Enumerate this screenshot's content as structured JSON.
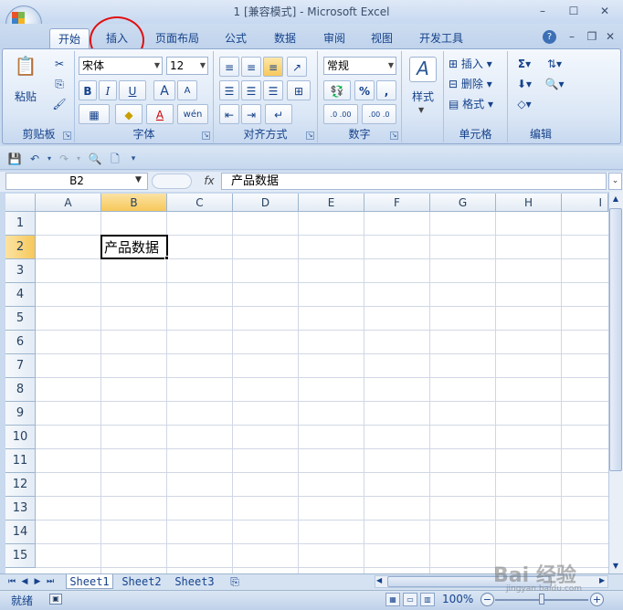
{
  "window": {
    "title": "1  [兼容模式] - Microsoft Excel",
    "min": "–",
    "max": "☐",
    "close": "✕",
    "help": "?",
    "doc_min": "–",
    "doc_restore": "❐",
    "doc_close": "✕"
  },
  "tabs": [
    {
      "label": "开始",
      "active": true
    },
    {
      "label": "插入"
    },
    {
      "label": "页面布局"
    },
    {
      "label": "公式"
    },
    {
      "label": "数据"
    },
    {
      "label": "审阅"
    },
    {
      "label": "视图"
    },
    {
      "label": "开发工具"
    }
  ],
  "ribbon": {
    "clipboard": {
      "label": "剪贴板",
      "paste": "粘贴"
    },
    "font": {
      "label": "字体",
      "font_name": "宋体",
      "font_size": "12",
      "bold": "B",
      "italic": "I",
      "underline": "U",
      "grow": "A",
      "shrink": "A",
      "font_color": "A",
      "phonetic": "wén"
    },
    "alignment": {
      "label": "对齐方式"
    },
    "number": {
      "label": "数字",
      "format": "常规",
      "percent": "%",
      "comma": ",",
      "inc_decimal": ".0 .00",
      "dec_decimal": ".00 .0"
    },
    "styles": {
      "label": "样式"
    },
    "cells": {
      "label": "单元格",
      "insert": "插入",
      "delete": "删除",
      "format": "格式"
    },
    "editing": {
      "label": "编辑"
    }
  },
  "formula_bar": {
    "name_box": "B2",
    "fx": "fx",
    "content": "产品数据"
  },
  "sheet": {
    "columns": [
      "A",
      "B",
      "C",
      "D",
      "E",
      "F",
      "G",
      "H",
      "I"
    ],
    "rows": [
      "1",
      "2",
      "3",
      "4",
      "5",
      "6",
      "7",
      "8",
      "9",
      "10",
      "11",
      "12",
      "13",
      "14",
      "15"
    ],
    "selected_column": "B",
    "selected_row": "2",
    "active_cell_value": "产品数据"
  },
  "sheet_tabs": [
    {
      "label": "Sheet1",
      "active": true
    },
    {
      "label": "Sheet2"
    },
    {
      "label": "Sheet3"
    }
  ],
  "status": {
    "text": "就绪",
    "zoom": "100%",
    "zoom_out": "−",
    "zoom_in": "+"
  },
  "watermark": {
    "text": "Bai 经验",
    "url": "jingyan.baidu.com"
  },
  "colors": {
    "accent": "#15428b",
    "selection": "#f7c85b",
    "highlight_circle": "#e01010"
  }
}
